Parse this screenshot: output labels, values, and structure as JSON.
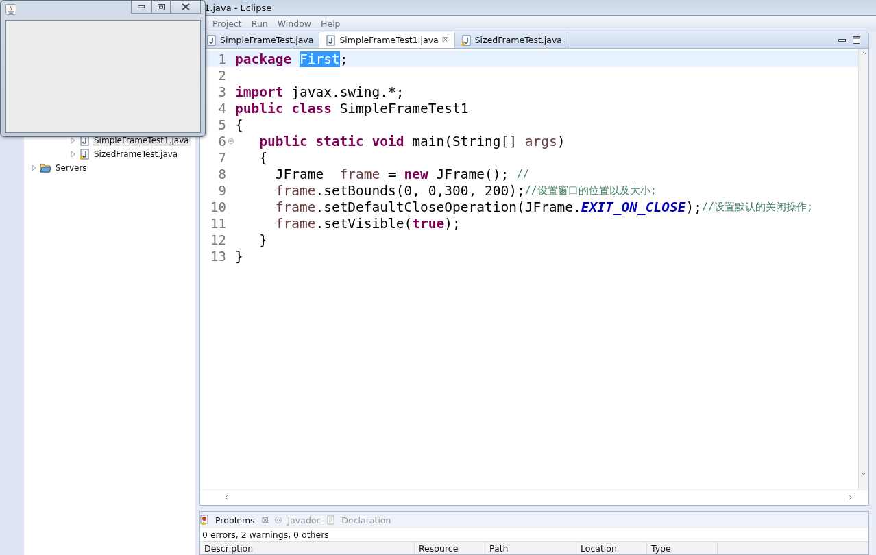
{
  "window": {
    "title": "1.java - Eclipse"
  },
  "menu": [
    "Project",
    "Run",
    "Window",
    "Help"
  ],
  "explorer": {
    "items": [
      {
        "label": "SimpleFrameTest1.java",
        "kind": "java-file",
        "selected": true,
        "warning": false
      },
      {
        "label": "SizedFrameTest.java",
        "kind": "java-file",
        "selected": false,
        "warning": true
      },
      {
        "label": "Servers",
        "kind": "folder",
        "selected": false,
        "warning": false
      }
    ]
  },
  "editor": {
    "tabs": [
      {
        "label": "SimpleFrameTest.java",
        "selected": false,
        "closable": false,
        "warning": false
      },
      {
        "label": "SimpleFrameTest1.java",
        "selected": true,
        "closable": true,
        "warning": false
      },
      {
        "label": "SizedFrameTest.java",
        "selected": false,
        "closable": false,
        "warning": true
      }
    ],
    "close_glyph": "☒",
    "lines": [
      {
        "number": "1",
        "current": true,
        "fold": false,
        "tokens": [
          {
            "text": "package ",
            "kind": "keyword"
          },
          {
            "text": "First",
            "kind": "selection"
          },
          {
            "text": ";",
            "kind": "plain"
          }
        ]
      },
      {
        "number": "2",
        "current": false,
        "fold": false
      },
      {
        "number": "3",
        "current": false,
        "fold": false,
        "tokens": [
          {
            "text": "import ",
            "kind": "keyword"
          },
          {
            "text": "javax.swing.*;",
            "kind": "plain"
          }
        ]
      },
      {
        "number": "4",
        "current": false,
        "fold": false,
        "tokens": [
          {
            "text": "public class ",
            "kind": "keyword"
          },
          {
            "text": "SimpleFrameTest1",
            "kind": "plain"
          }
        ]
      },
      {
        "number": "5",
        "current": false,
        "fold": false,
        "tokens": [
          {
            "text": "{",
            "kind": "plain"
          }
        ]
      },
      {
        "number": "6",
        "current": false,
        "fold": true,
        "tokens": [
          {
            "text": "   public static void ",
            "kind": "keyword"
          },
          {
            "text": "main(String[] ",
            "kind": "plain"
          },
          {
            "text": "args",
            "kind": "variable"
          },
          {
            "text": ")",
            "kind": "plain"
          }
        ]
      },
      {
        "number": "7",
        "current": false,
        "fold": false,
        "tokens": [
          {
            "text": "   {",
            "kind": "plain"
          }
        ]
      },
      {
        "number": "8",
        "current": false,
        "fold": false,
        "tokens": [
          {
            "text": "     JFrame  ",
            "kind": "plain"
          },
          {
            "text": "frame",
            "kind": "variable"
          },
          {
            "text": " = ",
            "kind": "plain"
          },
          {
            "text": "new ",
            "kind": "keyword"
          },
          {
            "text": "JFrame(); ",
            "kind": "plain"
          },
          {
            "text": "//",
            "kind": "comment"
          }
        ]
      },
      {
        "number": "9",
        "current": false,
        "fold": false,
        "tokens": [
          {
            "text": "     frame",
            "kind": "variable"
          },
          {
            "text": ".setBounds(0, 0,300, 200);",
            "kind": "plain"
          },
          {
            "text": "//设置窗口的位置以及大小;",
            "kind": "comment"
          }
        ]
      },
      {
        "number": "10",
        "current": false,
        "fold": false,
        "tokens": [
          {
            "text": "     frame",
            "kind": "variable"
          },
          {
            "text": ".setDefaultCloseOperation(JFrame.",
            "kind": "plain"
          },
          {
            "text": "EXIT_ON_CLOSE",
            "kind": "constant"
          },
          {
            "text": ");",
            "kind": "plain"
          },
          {
            "text": "//设置默认的关闭操作;",
            "kind": "comment"
          }
        ]
      },
      {
        "number": "11",
        "current": false,
        "fold": false,
        "tokens": [
          {
            "text": "     frame",
            "kind": "variable"
          },
          {
            "text": ".setVisible(",
            "kind": "plain"
          },
          {
            "text": "true",
            "kind": "keyword"
          },
          {
            "text": ");",
            "kind": "plain"
          }
        ]
      },
      {
        "number": "12",
        "current": false,
        "fold": false,
        "tokens": [
          {
            "text": "   }",
            "kind": "plain"
          }
        ]
      },
      {
        "number": "13",
        "current": false,
        "fold": false,
        "tokens": [
          {
            "text": "}",
            "kind": "plain"
          }
        ]
      }
    ]
  },
  "bottom_panel": {
    "tabs": [
      {
        "label": "Problems",
        "selected": true,
        "closable": true,
        "kind": "problems"
      },
      {
        "label": "Javadoc",
        "selected": false,
        "closable": false,
        "kind": "javadoc"
      },
      {
        "label": "Declaration",
        "selected": false,
        "closable": false,
        "kind": "declaration"
      }
    ],
    "summary": "0 errors, 2 warnings, 0 others",
    "columns": [
      "Description",
      "Resource",
      "Path",
      "Location",
      "Type"
    ]
  }
}
